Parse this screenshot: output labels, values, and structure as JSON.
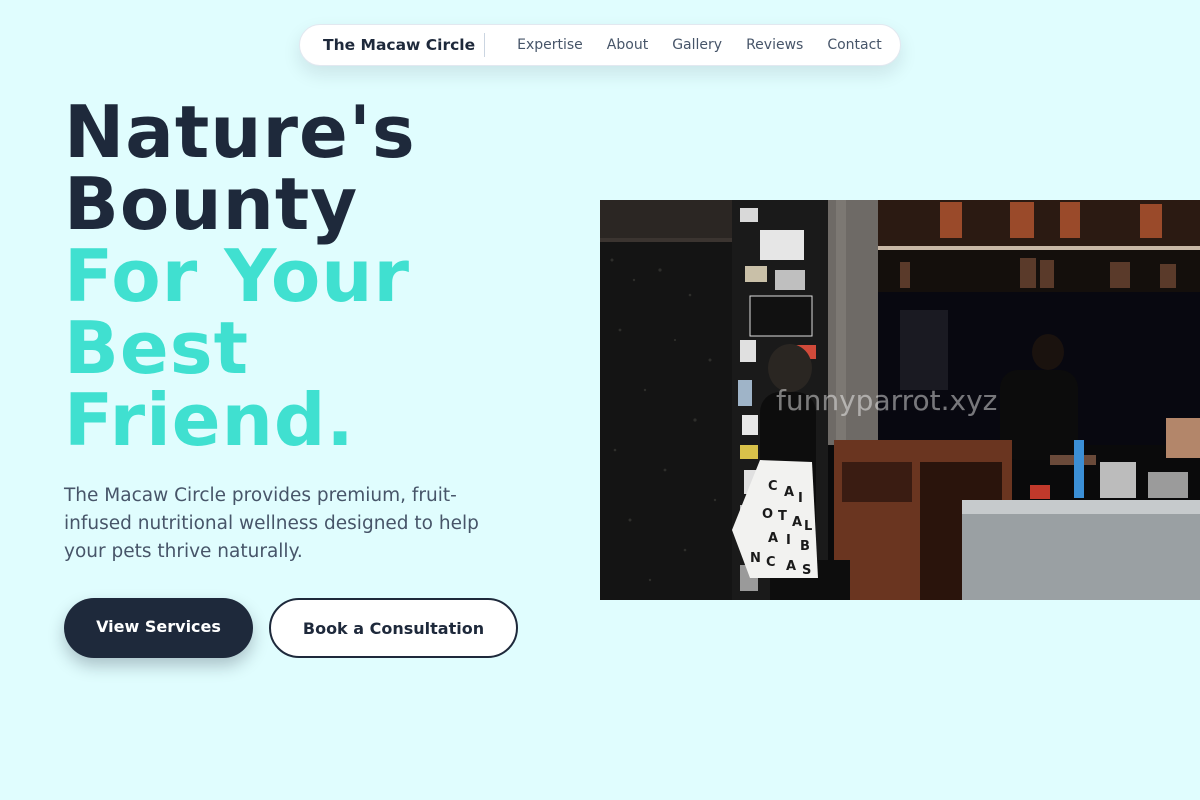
{
  "nav": {
    "brand": "The Macaw Circle",
    "links": [
      "Expertise",
      "About",
      "Gallery",
      "Reviews",
      "Contact"
    ]
  },
  "hero": {
    "title_dark": [
      "Nature's",
      "Bounty"
    ],
    "title_accent": [
      "For Your",
      "Best",
      "Friend."
    ],
    "description": "The Macaw Circle provides premium, fruit-infused nutritional wellness designed to help your pets thrive naturally.",
    "primary_button": "View Services",
    "secondary_button": "Book a Consultation"
  },
  "photo": {
    "watermark": "funnyparrot.xyz",
    "bag_letters": [
      "C",
      "A",
      "I",
      "O",
      "T",
      "A",
      "L",
      "N",
      "A",
      "I",
      "C",
      "B",
      "N",
      "C",
      "A",
      "S"
    ]
  },
  "colors": {
    "background": "#e0fdfe",
    "dark": "#1e293b",
    "accent": "#40e0d0",
    "muted_text": "#475569"
  }
}
